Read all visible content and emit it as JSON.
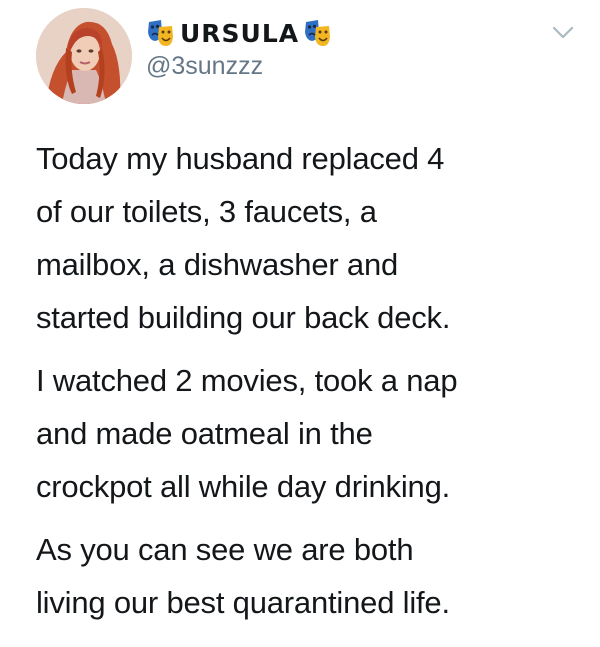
{
  "tweet": {
    "author": {
      "display_name": "URSULA",
      "handle": "@3sunzzz",
      "avatar_icon": "avatar-photo",
      "name_emoji_icon": "performing-arts-masks-icon"
    },
    "menu_icon": "chevron-down-icon",
    "paragraphs": [
      "Today my husband replaced 4\nof our toilets, 3 faucets, a\nmailbox, a dishwasher and\nstarted building our back deck.",
      "I watched 2 movies, took a nap\nand made oatmeal in the\ncrockpot all while day drinking.",
      "As you can see we are both\nliving our best quarantined life."
    ]
  },
  "colors": {
    "text_primary": "#14171a",
    "text_secondary": "#657786",
    "chevron": "#aab8c2",
    "background": "#ffffff"
  }
}
